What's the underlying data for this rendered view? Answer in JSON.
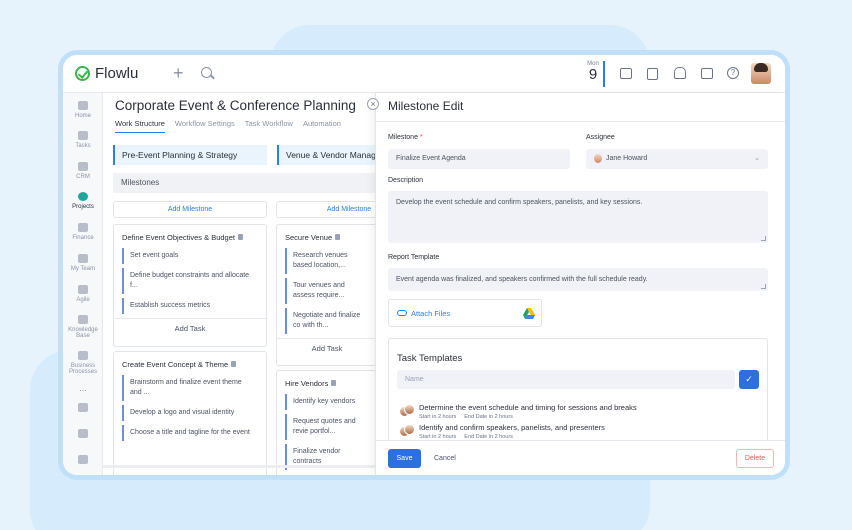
{
  "app": {
    "name": "Flowlu"
  },
  "topbar": {
    "date_day": "Mon",
    "date_num": "9"
  },
  "sidebar": {
    "items": [
      {
        "label": "Home",
        "icon": "home-icon"
      },
      {
        "label": "Tasks",
        "icon": "tasks-icon"
      },
      {
        "label": "CRM",
        "icon": "crm-icon"
      },
      {
        "label": "Projects",
        "icon": "projects-icon",
        "active": true
      },
      {
        "label": "Finance",
        "icon": "finance-icon"
      },
      {
        "label": "My Team",
        "icon": "team-icon"
      },
      {
        "label": "Agile",
        "icon": "agile-icon"
      },
      {
        "label": "Knowledge Base",
        "icon": "knowledge-icon"
      },
      {
        "label": "Business Processes",
        "icon": "processes-icon"
      },
      {
        "label": "...",
        "icon": "more-icon"
      }
    ]
  },
  "project": {
    "title": "Corporate Event & Conference Planning",
    "tabs": [
      "Work Structure",
      "Workflow Settings",
      "Task Workflow",
      "Automation"
    ],
    "stages": [
      "Pre-Event Planning & Strategy",
      "Venue & Vendor Manag"
    ],
    "milestones_label": "Milestones",
    "add_milestone": "Add Milestone",
    "add_task": "Add Task",
    "columns": [
      {
        "cards": [
          {
            "title": "Define Event Objectives & Budget",
            "tasks": [
              "Set event goals",
              "Define budget constraints and allocate f...",
              "Establish success metrics"
            ]
          },
          {
            "title": "Create Event Concept & Theme",
            "tasks": [
              "Brainstorm and finalize event theme and ...",
              "Develop a logo and visual identity",
              "Choose a title and tagline for the event"
            ]
          }
        ]
      },
      {
        "cards": [
          {
            "title": "Secure Venue",
            "tasks": [
              "Research venues based location,...",
              "Tour venues and assess require...",
              "Negotiate and finalize co with th..."
            ]
          },
          {
            "title": "Hire Vendors",
            "tasks": [
              "Identify key vendors",
              "Request quotes and revie portfol...",
              "Finalize vendor contracts"
            ]
          }
        ]
      }
    ]
  },
  "panel": {
    "title": "Milestone Edit",
    "milestone_label": "Milestone",
    "required_mark": "*",
    "milestone_value": "Finalize Event Agenda",
    "assignee_label": "Assignee",
    "assignee_value": "Jane Howard",
    "description_label": "Description",
    "description_value": "Develop the event schedule and confirm speakers, panelists, and key sessions.",
    "report_label": "Report Template",
    "report_value": "Event agenda was finalized, and speakers confirmed with the full schedule ready.",
    "attach_label": "Attach Files",
    "task_templates": {
      "title": "Task Templates",
      "placeholder": "Name",
      "items": [
        {
          "name": "Determine the event schedule and timing for sessions and breaks",
          "start": "Start in 2 hours",
          "end": "End Date in 2 hours"
        },
        {
          "name": "Identify and confirm speakers, panelists, and presenters",
          "start": "Start in 2 hours",
          "end": "End Date in 2 hours"
        }
      ]
    },
    "save": "Save",
    "cancel": "Cancel",
    "delete": "Delete"
  },
  "colors": {
    "accent": "#2b6fe0",
    "brand_green": "#3bb54a",
    "danger": "#e55555"
  }
}
